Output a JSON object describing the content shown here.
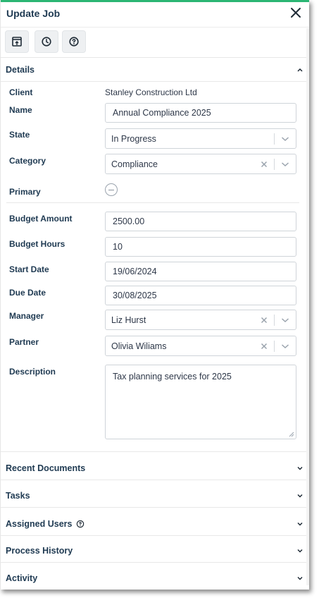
{
  "colors": {
    "accent": "#2bb673",
    "heading": "#1f3a52"
  },
  "header": {
    "title": "Update Job",
    "close_icon": "close-icon"
  },
  "toolbar": {
    "buttons": [
      "open-external-icon",
      "clock-icon",
      "help-icon"
    ]
  },
  "details": {
    "title": "Details",
    "client_label": "Client",
    "client_value": "Stanley Construction Ltd",
    "name_label": "Name",
    "name_value": "Annual Compliance 2025",
    "state_label": "State",
    "state_value": "In Progress",
    "category_label": "Category",
    "category_value": "Compliance",
    "primary_label": "Primary",
    "budget_amount_label": "Budget Amount",
    "budget_amount_value": "2500.00",
    "budget_hours_label": "Budget Hours",
    "budget_hours_value": "10",
    "start_date_label": "Start Date",
    "start_date_value": "19/06/2024",
    "due_date_label": "Due Date",
    "due_date_value": "30/08/2025",
    "manager_label": "Manager",
    "manager_value": "Liz Hurst",
    "partner_label": "Partner",
    "partner_value": "Olivia Wiliams",
    "description_label": "Description",
    "description_value": "Tax planning services for 2025"
  },
  "sections": {
    "recent_documents": "Recent Documents",
    "tasks": "Tasks",
    "assigned_users": "Assigned Users",
    "process_history": "Process History",
    "activity": "Activity"
  }
}
